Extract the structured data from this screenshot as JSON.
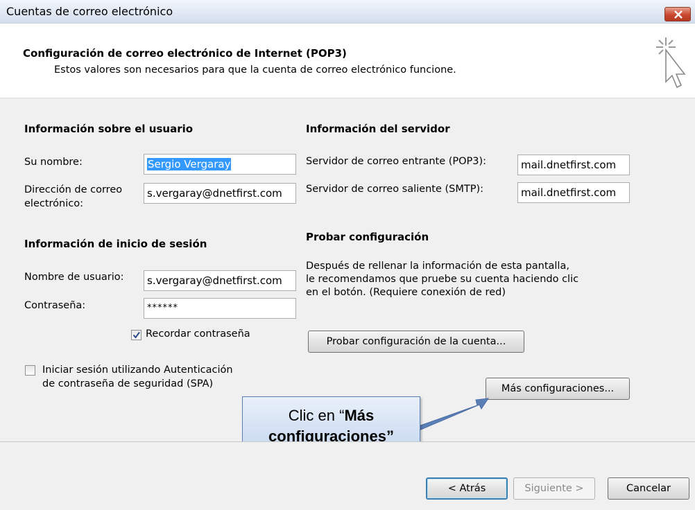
{
  "window": {
    "title": "Cuentas de correo electrónico"
  },
  "header": {
    "title": "Configuración de correo electrónico de Internet (POP3)",
    "subtitle": "Estos valores son necesarios para que la cuenta de correo electrónico funcione."
  },
  "user_info": {
    "heading": "Información sobre el usuario",
    "name_label": "Su nombre:",
    "name_value": "Sergio Vergaray",
    "email_label_1": "Dirección de correo",
    "email_label_2": "electrónico:",
    "email_value": "s.vergaray@dnetfirst.com"
  },
  "login_info": {
    "heading": "Información de inicio de sesión",
    "username_label": "Nombre de usuario:",
    "username_value": "s.vergaray@dnetfirst.com",
    "password_label": "Contraseña:",
    "password_value": "******",
    "remember_label": "Recordar contraseña",
    "remember_checked": true,
    "spa_label_1": "Iniciar sesión utilizando Autenticación",
    "spa_label_2": "de contraseña de seguridad (SPA)",
    "spa_checked": false
  },
  "server_info": {
    "heading": "Información del servidor",
    "incoming_label": "Servidor de correo entrante (POP3):",
    "incoming_value": "mail.dnetfirst.com",
    "outgoing_label": "Servidor de correo saliente (SMTP):",
    "outgoing_value": "mail.dnetfirst.com"
  },
  "test": {
    "heading": "Probar configuración",
    "desc_1": "Después de rellenar la información de esta pantalla,",
    "desc_2": "le recomendamos que pruebe su cuenta haciendo clic",
    "desc_3": "en el botón. (Requiere conexión de red)",
    "test_button": "Probar configuración de la cuenta...",
    "more_button": "Más configuraciones..."
  },
  "callout": {
    "prefix": "Clic en “",
    "bold_1": "Más",
    "bold_2": "configuraciones”"
  },
  "footer": {
    "back": "< Atrás",
    "next": "Siguiente >",
    "cancel": "Cancelar"
  },
  "colors": {
    "selection": "#3399ff",
    "callout_border": "#5a7fb6",
    "close_red": "#c9472e"
  }
}
